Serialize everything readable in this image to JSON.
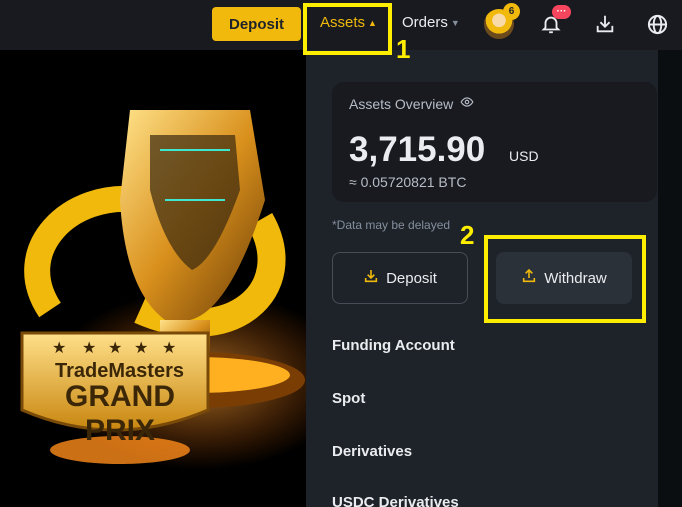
{
  "topbar": {
    "deposit_label": "Deposit",
    "assets_label": "Assets",
    "orders_label": "Orders",
    "avatar_badge": "6",
    "bell_badge": "···",
    "icons": [
      "avatar",
      "bell-icon",
      "download-icon",
      "globe-icon"
    ]
  },
  "annotations": {
    "marker_1": "1",
    "marker_2": "2",
    "color": "#ffee00"
  },
  "banner": {
    "title_line1": "TradeMasters",
    "title_line2": "GRAND PRIX"
  },
  "assets_dropdown": {
    "overview_label": "Assets Overview",
    "amount": "3,715.90",
    "currency": "USD",
    "btc_equivalent": "≈ 0.05720821 BTC",
    "delay_note": "*Data may be delayed",
    "deposit_button": "Deposit",
    "withdraw_button": "Withdraw",
    "menu": [
      "Funding Account",
      "Spot",
      "Derivatives",
      "USDC Derivatives"
    ]
  },
  "colors": {
    "accent": "#f0b90b",
    "panel": "#1e2329",
    "topbar": "#181a20",
    "alert": "#f6465d"
  }
}
